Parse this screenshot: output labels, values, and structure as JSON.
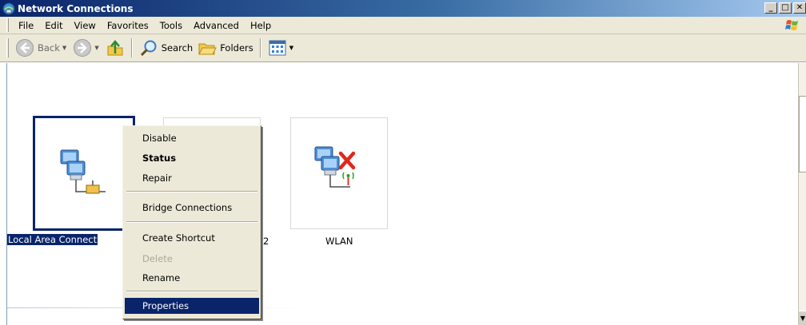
{
  "window": {
    "title": "Network Connections",
    "buttons": {
      "minimize": "_",
      "maximize": "□",
      "close": "✕"
    }
  },
  "menubar": {
    "items": [
      "File",
      "Edit",
      "View",
      "Favorites",
      "Tools",
      "Advanced",
      "Help"
    ]
  },
  "toolbar": {
    "back_label": "Back",
    "search_label": "Search",
    "folders_label": "Folders"
  },
  "connections": [
    {
      "label": "Local Area Connect",
      "selected": true,
      "icon": "lan-connection-icon"
    },
    {
      "label": "2",
      "selected": false,
      "icon": "lan-connection-icon"
    },
    {
      "label": "WLAN",
      "selected": false,
      "icon": "wireless-disconnected-icon"
    }
  ],
  "context_menu": {
    "items": [
      {
        "label": "Disable",
        "style": "normal"
      },
      {
        "label": "Status",
        "style": "bold"
      },
      {
        "label": "Repair",
        "style": "normal"
      },
      {
        "label": "Bridge Connections",
        "style": "normal"
      },
      {
        "label": "Create Shortcut",
        "style": "normal"
      },
      {
        "label": "Delete",
        "style": "disabled"
      },
      {
        "label": "Rename",
        "style": "normal"
      },
      {
        "label": "Properties",
        "style": "highlighted"
      }
    ]
  },
  "colors": {
    "selection": "#0a246a",
    "menu_bg": "#ece9d8",
    "delete_x": "#e0281c",
    "wireless_signal": "#2aa02a"
  }
}
